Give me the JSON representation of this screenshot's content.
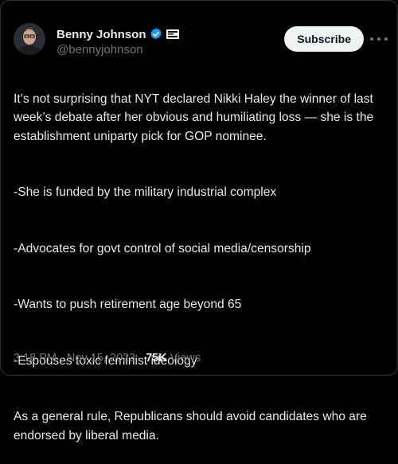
{
  "author": {
    "display_name": "Benny Johnson",
    "handle": "@bennyjohnson",
    "verified_color": "#1d9bf0"
  },
  "header": {
    "subscribe_label": "Subscribe"
  },
  "tweet": {
    "paragraphs": [
      "It’s not surprising that NYT declared Nikki Haley the winner of last week’s debate after her obvious and humiliating loss — she is the establishment uniparty pick for GOP nominee.",
      "-She is funded by the military industrial complex",
      "-Advocates for govt control of social media/censorship",
      "-Wants to push retirement age beyond 65",
      "-Espouses toxic feminist ideology",
      "As a general rule, Republicans should avoid candidates who are endorsed by liberal media."
    ]
  },
  "meta": {
    "time": "3:18 PM",
    "separator": "·",
    "date": "Nov 15, 2023",
    "views_count": "75K",
    "views_label": "Views"
  }
}
